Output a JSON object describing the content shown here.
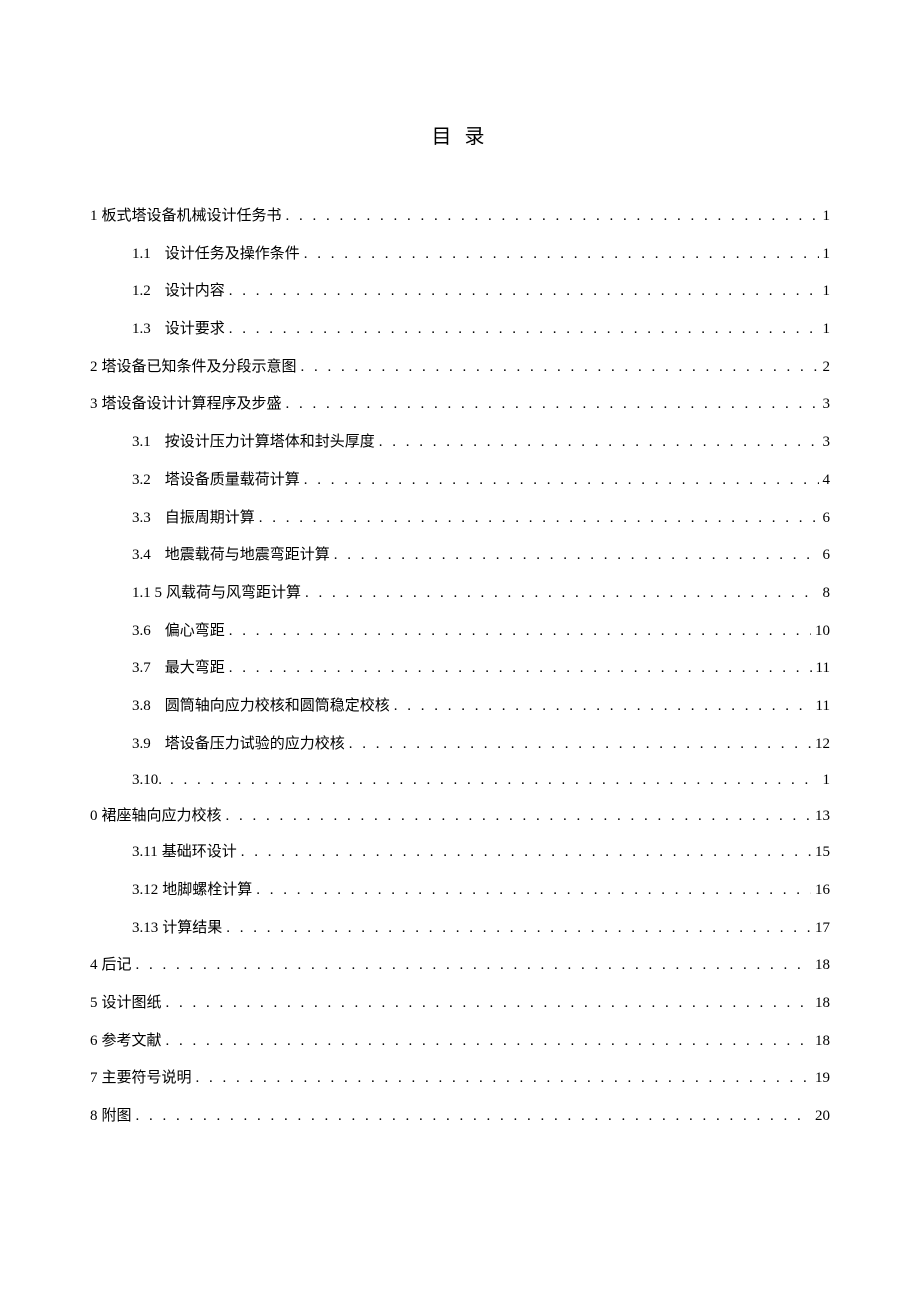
{
  "title": "目 录",
  "entries": [
    {
      "level": 0,
      "num": "1",
      "text": "板式塔设备机械设计任务书",
      "page": "1",
      "tight": true
    },
    {
      "level": 1,
      "num": "1.1",
      "text": "设计任务及操作条件",
      "page": "1"
    },
    {
      "level": 1,
      "num": "1.2",
      "text": "设计内容",
      "page": "1"
    },
    {
      "level": 1,
      "num": "1.3",
      "text": "设计要求",
      "page": "1"
    },
    {
      "level": 0,
      "num": "2",
      "text": "塔设备已知条件及分段示意图",
      "page": "2",
      "tight": true
    },
    {
      "level": 0,
      "num": "3",
      "text": "塔设备设计计算程序及步盛",
      "page": "3",
      "tight": true
    },
    {
      "level": 1,
      "num": "3.1",
      "text": "按设计压力计算塔体和封头厚度",
      "page": "3"
    },
    {
      "level": 1,
      "num": "3.2",
      "text": "塔设备质量载荷计算",
      "page": "4"
    },
    {
      "level": 1,
      "num": "3.3",
      "text": "自振周期计算",
      "page": "6"
    },
    {
      "level": 1,
      "num": "3.4",
      "text": "地震载荷与地震弯距计算",
      "page": "6"
    },
    {
      "level": 1,
      "num": "1.1  5",
      "text": "风载荷与风弯距计算",
      "page": "8",
      "tight": true
    },
    {
      "level": 1,
      "num": "3.6",
      "text": "偏心弯距",
      "page": "10"
    },
    {
      "level": 1,
      "num": "3.7",
      "text": "最大弯距",
      "page": "11"
    },
    {
      "level": 1,
      "num": "3.8",
      "text": "圆筒轴向应力校核和圆筒稳定校核",
      "page": "11"
    },
    {
      "level": 1,
      "num": "3.9",
      "text": "塔设备压力试验的应力校核",
      "page": "12"
    },
    {
      "special": "3.10"
    },
    {
      "level": 1,
      "num": "3.11",
      "text": "基础环设计",
      "page": "15",
      "tight": true
    },
    {
      "level": 1,
      "num": "3.12",
      "text": "地脚螺栓计算",
      "page": "16",
      "tight": true
    },
    {
      "level": 1,
      "num": "3.13",
      "text": "计算结果",
      "page": "17",
      "tight": true
    },
    {
      "level": 0,
      "num": "4",
      "text": "后记",
      "page": "18",
      "tight": true
    },
    {
      "level": 0,
      "num": "5",
      "text": "设计图纸",
      "page": "18",
      "tight": true
    },
    {
      "level": 0,
      "num": "6",
      "text": "参考文献",
      "page": "18",
      "tight": true
    },
    {
      "level": 0,
      "num": "7",
      "text": "主要符号说明",
      "page": "19",
      "tight": true
    },
    {
      "level": 0,
      "num": "8",
      "text": "附图",
      "page": "20",
      "tight": true,
      "last": true
    }
  ],
  "special310": {
    "num1": "3.10.",
    "page1": "1",
    "num2": "0",
    "text2": "裙座轴向应力校核",
    "page2": "13"
  }
}
